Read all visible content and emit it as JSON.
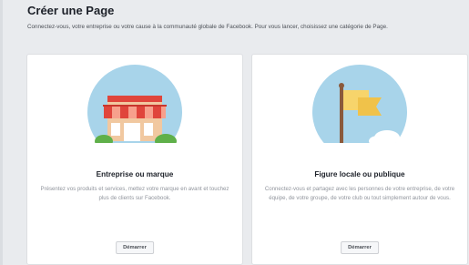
{
  "header": {
    "title": "Créer une Page",
    "subtitle": "Connectez-vous, votre entreprise ou votre cause à la communauté globale de Facebook. Pour vous lancer, choisissez une catégorie de Page."
  },
  "cards": [
    {
      "title": "Entreprise ou marque",
      "description": "Présentez vos produits et services, mettez votre marque en avant et touchez plus de clients sur Facebook.",
      "button_label": "Démarrer",
      "icon": "storefront-icon"
    },
    {
      "title": "Figure locale ou publique",
      "description": "Connectez-vous et partagez avec les personnes de votre entreprise, de votre équipe, de votre groupe, de votre club ou tout simplement autour de vous.",
      "button_label": "Démarrer",
      "icon": "flag-icon"
    }
  ],
  "colors": {
    "background": "#e9ebee",
    "card": "#ffffff",
    "circle": "#a8d4ea",
    "awning_red": "#e0453b",
    "flag_yellow": "#f7d46b",
    "bush_green": "#5fb04a"
  }
}
